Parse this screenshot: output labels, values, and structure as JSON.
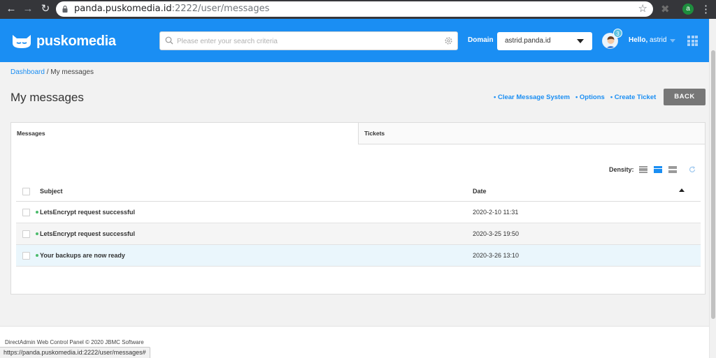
{
  "browser": {
    "url_host": "panda.puskomedia.id",
    "url_path": ":2222/user/messages",
    "profile_initial": "a",
    "status_url": "https://panda.puskomedia.id:2222/user/messages#"
  },
  "header": {
    "brand": "puskomedia",
    "search_placeholder": "Please enter your search criteria",
    "domain_label": "Domain",
    "domain_value": "astrid.panda.id",
    "notification_count": "3",
    "greeting": "Hello,",
    "username": "astrid",
    "colors": {
      "bar": "#1a8ef3"
    }
  },
  "breadcrumb": {
    "root": "Dashboard",
    "separator": " / ",
    "current": "My messages"
  },
  "page": {
    "title": "My messages",
    "actions": [
      "• Clear Message System",
      "• Options",
      "• Create Ticket"
    ],
    "back_label": "BACK"
  },
  "tabs": [
    "Messages",
    "Tickets"
  ],
  "table": {
    "density_label": "Density:",
    "columns": {
      "subject": "Subject",
      "date": "Date"
    },
    "rows": [
      {
        "subject": "LetsEncrypt request successful",
        "date": "2020-2-10 11:31"
      },
      {
        "subject": "LetsEncrypt request successful",
        "date": "2020-3-25 19:50"
      },
      {
        "subject": "Your backups are now ready",
        "date": "2020-3-26 13:10"
      }
    ]
  },
  "footer": {
    "copyright": "DirectAdmin Web Control Panel © 2020 JBMC Software"
  }
}
